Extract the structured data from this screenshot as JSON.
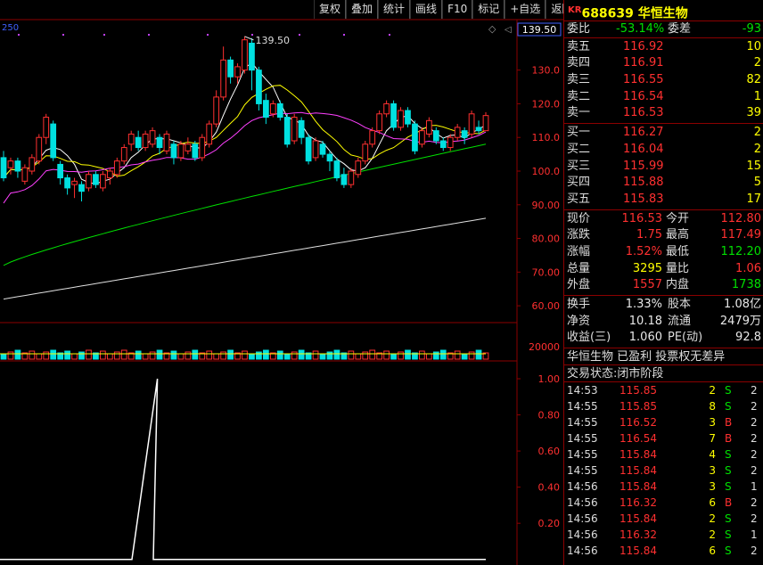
{
  "toolbar": [
    "复权",
    "叠加",
    "统计",
    "画线",
    "F10",
    "标记",
    "+自选",
    "返回"
  ],
  "chart": {
    "top_left_label": "250",
    "current_price_label": "139.50",
    "peak_label": "139.50",
    "price_axis": [
      "130.0",
      "120.0",
      "110.0",
      "100.0",
      "90.00",
      "80.00",
      "70.00",
      "60.00"
    ],
    "volume_axis": [
      "20000"
    ],
    "indicator_axis": [
      "1.00",
      "0.80",
      "0.60",
      "0.40",
      "0.20"
    ],
    "colors": {
      "up": "#ff3030",
      "down": "#00e0e0",
      "ma5": "#ffffff",
      "ma10": "#ffff00",
      "ma20": "#ff40ff",
      "ma60": "#00e000",
      "ma250": "#e0e0e0",
      "axis": "#8b0000"
    }
  },
  "chart_data": {
    "type": "candlestick",
    "ylim": [
      55,
      145
    ],
    "candles": [
      [
        104,
        98,
        106,
        97
      ],
      [
        101,
        103,
        104,
        99
      ],
      [
        103,
        100,
        104,
        98
      ],
      [
        97,
        101,
        102,
        96
      ],
      [
        100,
        104,
        105,
        99
      ],
      [
        103,
        110,
        111,
        102
      ],
      [
        110,
        116,
        117,
        108
      ],
      [
        114,
        104,
        115,
        103
      ],
      [
        102,
        98,
        103,
        96
      ],
      [
        98,
        95,
        99,
        93
      ],
      [
        96,
        97,
        98,
        92
      ],
      [
        96,
        94,
        97,
        91
      ],
      [
        95,
        99,
        100,
        94
      ],
      [
        99,
        96,
        100,
        95
      ],
      [
        95,
        99,
        100,
        94
      ],
      [
        98,
        100,
        101,
        96
      ],
      [
        99,
        103,
        104,
        98
      ],
      [
        103,
        107,
        108,
        102
      ],
      [
        108,
        111,
        112,
        106
      ],
      [
        110,
        107,
        112,
        106
      ],
      [
        107,
        111,
        112,
        106
      ],
      [
        108,
        112,
        113,
        107
      ],
      [
        110,
        107,
        111,
        105
      ],
      [
        106,
        111,
        112,
        105
      ],
      [
        108,
        104,
        109,
        102
      ],
      [
        104,
        108,
        109,
        103
      ],
      [
        106,
        108,
        110,
        105
      ],
      [
        108,
        104,
        109,
        103
      ],
      [
        104,
        110,
        111,
        103
      ],
      [
        108,
        114,
        115,
        107
      ],
      [
        114,
        122,
        124,
        113
      ],
      [
        122,
        133,
        137,
        121
      ],
      [
        133,
        128,
        134,
        126
      ],
      [
        128,
        131,
        132,
        126
      ],
      [
        130,
        139,
        140,
        129
      ],
      [
        138,
        130,
        139.5,
        124
      ],
      [
        130,
        120,
        131,
        118
      ],
      [
        121,
        116,
        123,
        114
      ],
      [
        117,
        120,
        121,
        116
      ],
      [
        120,
        116,
        121,
        115
      ],
      [
        116,
        108,
        117,
        107
      ],
      [
        109,
        116,
        117,
        108
      ],
      [
        115,
        110,
        116,
        108
      ],
      [
        110,
        103,
        111,
        102
      ],
      [
        104,
        109,
        110,
        103
      ],
      [
        108,
        105,
        109,
        104
      ],
      [
        105,
        103,
        106,
        100
      ],
      [
        103,
        98,
        104,
        97
      ],
      [
        99,
        96,
        101,
        95
      ],
      [
        96,
        100,
        101,
        95
      ],
      [
        99,
        103,
        104,
        98
      ],
      [
        103,
        108,
        109,
        102
      ],
      [
        108,
        112,
        113,
        107
      ],
      [
        112,
        117,
        118,
        111
      ],
      [
        117,
        120,
        121,
        116
      ],
      [
        120,
        113,
        121,
        112
      ],
      [
        113,
        118,
        119,
        112
      ],
      [
        118,
        114,
        119,
        113
      ],
      [
        114,
        106,
        115,
        105
      ],
      [
        108,
        112,
        113,
        107
      ],
      [
        111,
        115,
        116,
        110
      ],
      [
        112,
        109,
        113,
        108
      ],
      [
        109,
        107,
        110,
        106
      ],
      [
        107,
        110,
        111,
        106
      ],
      [
        110,
        113,
        114,
        109
      ],
      [
        112,
        110,
        113,
        108
      ],
      [
        111,
        117,
        118,
        110
      ],
      [
        113,
        112,
        115,
        111
      ],
      [
        112,
        116.5,
        117.5,
        112
      ]
    ],
    "indicator_peak": 1.0
  },
  "quote": {
    "code": "688639",
    "name": "华恒生物",
    "market": "KR",
    "weibi_label": "委比",
    "weibi_value": "-53.14%",
    "weicha_label": "委差",
    "weicha_value": "-93",
    "asks": [
      {
        "label": "卖五",
        "price": "116.92",
        "vol": "10"
      },
      {
        "label": "卖四",
        "price": "116.91",
        "vol": "2"
      },
      {
        "label": "卖三",
        "price": "116.55",
        "vol": "82"
      },
      {
        "label": "卖二",
        "price": "116.54",
        "vol": "1"
      },
      {
        "label": "卖一",
        "price": "116.53",
        "vol": "39"
      }
    ],
    "bids": [
      {
        "label": "买一",
        "price": "116.27",
        "vol": "2"
      },
      {
        "label": "买二",
        "price": "116.04",
        "vol": "2"
      },
      {
        "label": "买三",
        "price": "115.99",
        "vol": "15"
      },
      {
        "label": "买四",
        "price": "115.88",
        "vol": "5"
      },
      {
        "label": "买五",
        "price": "115.83",
        "vol": "17"
      }
    ],
    "stats": [
      {
        "l1": "现价",
        "v1": "116.53",
        "c1": "red",
        "l2": "今开",
        "v2": "112.80",
        "c2": "red"
      },
      {
        "l1": "涨跌",
        "v1": "1.75",
        "c1": "red",
        "l2": "最高",
        "v2": "117.49",
        "c2": "red"
      },
      {
        "l1": "涨幅",
        "v1": "1.52%",
        "c1": "red",
        "l2": "最低",
        "v2": "112.20",
        "c2": "green"
      },
      {
        "l1": "总量",
        "v1": "3295",
        "c1": "yellow",
        "l2": "量比",
        "v2": "1.06",
        "c2": "red"
      },
      {
        "l1": "外盘",
        "v1": "1557",
        "c1": "red",
        "l2": "内盘",
        "v2": "1738",
        "c2": "green"
      }
    ],
    "fin": [
      {
        "l1": "换手",
        "v1": "1.33%",
        "l2": "股本",
        "v2": "1.08亿"
      },
      {
        "l1": "净资",
        "v1": "10.18",
        "l2": "流通",
        "v2": "2479万"
      },
      {
        "l1": "收益(三)",
        "v1": "1.060",
        "l2": "PE(动)",
        "v2": "92.8"
      }
    ],
    "info1": "华恒生物 已盈利 投票权无差异",
    "info2": "交易状态:闭市阶段",
    "ticks": [
      {
        "t": "14:53",
        "p": "115.85",
        "v": "2",
        "s": "S",
        "n": "2"
      },
      {
        "t": "14:55",
        "p": "115.85",
        "v": "8",
        "s": "S",
        "n": "2"
      },
      {
        "t": "14:55",
        "p": "116.52",
        "v": "3",
        "s": "B",
        "n": "2"
      },
      {
        "t": "14:55",
        "p": "116.54",
        "v": "7",
        "s": "B",
        "n": "2"
      },
      {
        "t": "14:55",
        "p": "115.84",
        "v": "4",
        "s": "S",
        "n": "2"
      },
      {
        "t": "14:55",
        "p": "115.84",
        "v": "3",
        "s": "S",
        "n": "2"
      },
      {
        "t": "14:56",
        "p": "115.84",
        "v": "3",
        "s": "S",
        "n": "1"
      },
      {
        "t": "14:56",
        "p": "116.32",
        "v": "6",
        "s": "B",
        "n": "2"
      },
      {
        "t": "14:56",
        "p": "115.84",
        "v": "2",
        "s": "S",
        "n": "2"
      },
      {
        "t": "14:56",
        "p": "116.32",
        "v": "2",
        "s": "S",
        "n": "1"
      },
      {
        "t": "14:56",
        "p": "115.84",
        "v": "6",
        "s": "S",
        "n": "2"
      }
    ]
  }
}
